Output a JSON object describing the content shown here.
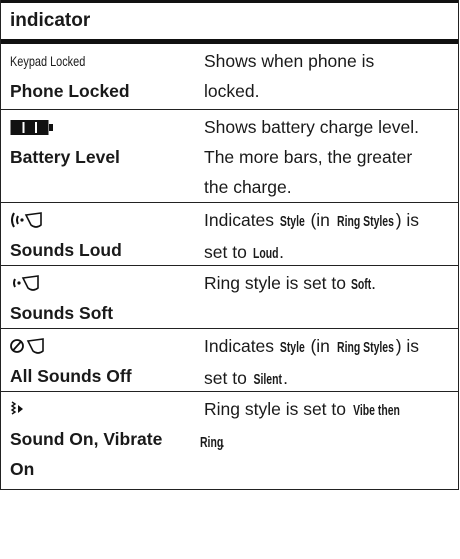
{
  "header": {
    "title": "indicator"
  },
  "rows": [
    {
      "icon": "keypad-locked-text",
      "icon_text": "Keypad Locked",
      "name": "Phone Locked",
      "desc": [
        "Shows when phone is",
        "locked."
      ]
    },
    {
      "icon": "battery-icon",
      "name": "Battery Level",
      "desc": [
        "Shows battery charge level.",
        "The more bars, the greater",
        "the charge."
      ]
    },
    {
      "icon": "ring-loud-icon",
      "name": "Sounds Loud",
      "desc_parts": [
        "Indicates ",
        "Style",
        " (in ",
        "Ring Styles",
        ") is",
        "set to ",
        "Loud",
        "."
      ]
    },
    {
      "icon": "ring-soft-icon",
      "name": "Sounds Soft",
      "desc_parts": [
        "Ring style is set to ",
        "Soft",
        "."
      ]
    },
    {
      "icon": "ring-off-icon",
      "name": "All Sounds Off",
      "desc_parts": [
        "Indicates ",
        "Style",
        " (in ",
        "Ring Styles",
        ") is",
        "set to ",
        "Silent",
        "."
      ]
    },
    {
      "icon": "vibrate-then-ring-icon",
      "name_lines": [
        "Sound On, Vibrate",
        "On"
      ],
      "desc_parts": [
        "Ring style is set to ",
        "Vibe then",
        "Ring",
        "."
      ]
    }
  ]
}
